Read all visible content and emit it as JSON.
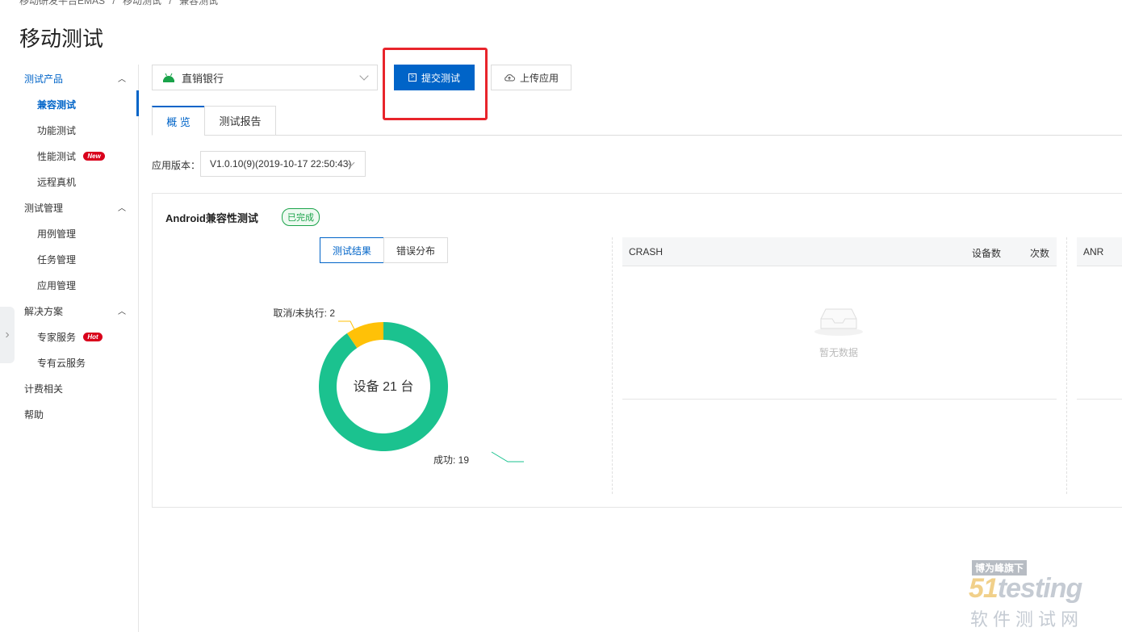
{
  "breadcrumb": [
    "移动研发平台EMAS",
    "/",
    "移动测试",
    "/",
    "兼容测试"
  ],
  "page_title": "移动测试",
  "sidebar": {
    "groups": [
      {
        "label": "测试产品",
        "items": [
          {
            "label": "兼容测试"
          },
          {
            "label": "功能测试"
          },
          {
            "label": "性能测试",
            "badge": "New"
          },
          {
            "label": "远程真机"
          }
        ]
      },
      {
        "label": "测试管理",
        "items": [
          {
            "label": "用例管理"
          },
          {
            "label": "任务管理"
          },
          {
            "label": "应用管理"
          }
        ]
      },
      {
        "label": "解决方案",
        "items": [
          {
            "label": "专家服务",
            "badge": "Hot"
          },
          {
            "label": "专有云服务"
          }
        ]
      }
    ],
    "top_items": [
      {
        "label": "计费相关"
      },
      {
        "label": "帮助"
      }
    ]
  },
  "toolbar": {
    "app_select_value": "直销银行",
    "submit_label": "提交测试",
    "upload_label": "上传应用"
  },
  "tabs": [
    {
      "label": "概 览"
    },
    {
      "label": "测试报告"
    }
  ],
  "version": {
    "label": "应用版本：",
    "value": "V1.0.10(9)(2019-10-17 22:50:43)"
  },
  "panel": {
    "title": "Android兼容性测试",
    "status": "已完成",
    "segments": [
      {
        "label": "测试结果"
      },
      {
        "label": "错误分布"
      }
    ],
    "crash_table": {
      "title": "CRASH",
      "col1": "设备数",
      "col2": "次数",
      "empty": "暂无数据"
    },
    "anr_table": {
      "title": "ANR"
    }
  },
  "chart_data": {
    "type": "pie",
    "center_label": "设备 21 台",
    "slices": [
      {
        "name": "成功",
        "value": 19,
        "color": "#1bc28f",
        "label": "成功: 19"
      },
      {
        "name": "取消/未执行",
        "value": 2,
        "color": "#ffc107",
        "label": "取消/未执行: 2"
      }
    ]
  },
  "watermark": {
    "top": "博为峰旗下",
    "logo_num": "51",
    "logo_text": "testing",
    "sub": "软件测试网"
  },
  "colors": {
    "primary": "#0064c8",
    "highlight": "#e8242b",
    "success": "#1bc28f",
    "warning": "#ffc107"
  }
}
